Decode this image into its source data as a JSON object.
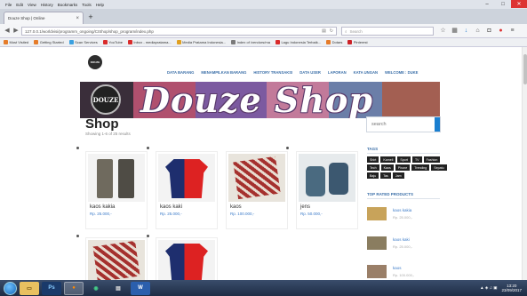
{
  "browser": {
    "menu": [
      "File",
      "Edit",
      "View",
      "History",
      "Bookmarks",
      "Tools",
      "Help"
    ],
    "tab_title": "Douze Shop | Online",
    "url": "127.0.0.1/worldvisi/programm_ongoing/CIShop/shop_program/index.php",
    "search_placeholder": "Search",
    "bookmarks": [
      {
        "label": "Most Visited",
        "color": "#e57c2a"
      },
      {
        "label": "Getting Started",
        "color": "#e57c2a"
      },
      {
        "label": "Scan Services",
        "color": "#3aa0e0"
      },
      {
        "label": "YouTube",
        "color": "#d92b2b"
      },
      {
        "label": "Inbox - mediapratama...",
        "color": "#d92b2b"
      },
      {
        "label": "Media Pratama Indonesia...",
        "color": "#e0a020"
      },
      {
        "label": "Index of /vendors/ma",
        "color": "#7a7a7a"
      },
      {
        "label": "Lagu Indonesia Terbaik...",
        "color": "#d92b2b"
      },
      {
        "label": "Dotars",
        "color": "#e57c2a"
      },
      {
        "label": "Pinterest",
        "color": "#cc2127"
      }
    ]
  },
  "site": {
    "logo_text": "DOUZE",
    "nav": [
      "DATA BARANG",
      "MENAMPILKAN BARANG",
      "HISTORY TRANSAKSI",
      "DATA USER",
      "LAPORAN",
      "KATA UNGAN",
      "WELCOME : DUKE"
    ],
    "banner_logo": "DOUZE",
    "banner_title": "Douze Shop",
    "shop_title": "Shop",
    "shop_count": "Showing 1-6 of 25 results",
    "search_placeholder": "search"
  },
  "products": [
    {
      "name": "kaos kakia",
      "price": "Rp. 25.000,-"
    },
    {
      "name": "kaos kaki",
      "price": "Rp. 25.000,-"
    },
    {
      "name": "kaos",
      "price": "Rp. 100.000,-"
    },
    {
      "name": "jens",
      "price": "Rp. 50.000,-"
    }
  ],
  "sidebar": {
    "tags_heading": "TAGS",
    "tags": [
      "Shirt",
      "Kameli",
      "Sport",
      "TV",
      "Fashion",
      "Tech",
      "Kaos",
      "Phone",
      "Trending",
      "Sepatu",
      "Baju",
      "Tas",
      "Jam"
    ],
    "rated_heading": "TOP RATED PRODUCTS",
    "rated": [
      {
        "name": "kaos kakia",
        "price": "Rp. 25.000,-"
      },
      {
        "name": "kaos kaki",
        "price": "Rp. 25.000,-"
      },
      {
        "name": "kaos",
        "price": "Rp. 100.000,-"
      }
    ]
  },
  "taskbar": {
    "time": "13:20",
    "date": "23/09/2017",
    "apps": [
      "Explorer",
      "PS",
      "Firefox",
      "Media",
      "Files",
      "Word"
    ]
  }
}
